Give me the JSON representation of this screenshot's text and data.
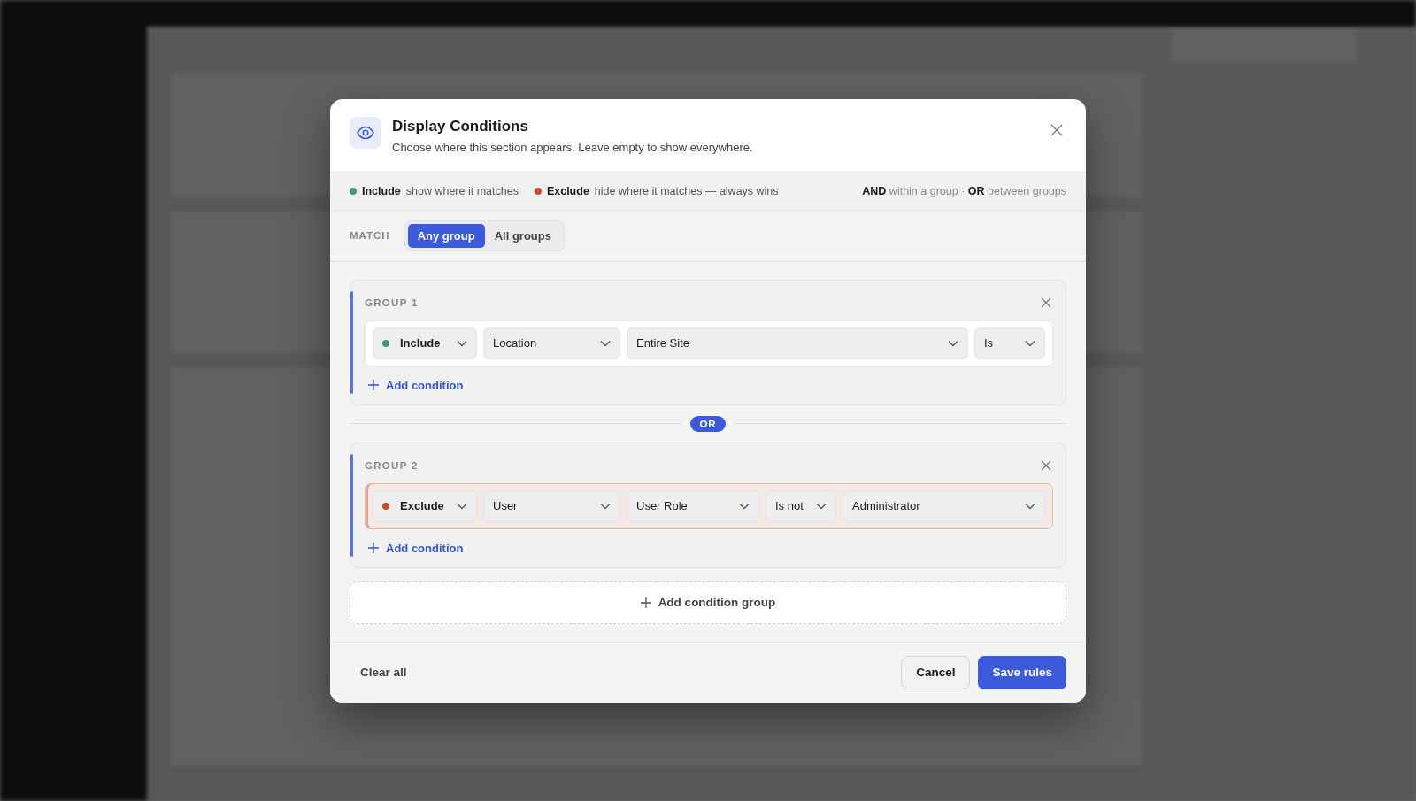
{
  "dialog": {
    "title": "Display Conditions",
    "subtitle": "Choose where this section appears. Leave empty to show everywhere.",
    "legend": [
      {
        "label": "Include",
        "text": "show where it matches",
        "color": "#3e9a6f"
      },
      {
        "label": "Exclude",
        "text": "hide where it matches — always wins",
        "color": "#c0502a"
      }
    ],
    "logic_hint": "**AND** within a group · **OR** between groups",
    "match": {
      "label": "MATCH",
      "options": [
        {
          "label": "Any group",
          "selected": true
        },
        {
          "label": "All groups",
          "selected": false
        }
      ]
    },
    "groups": [
      {
        "title": "GROUP 1",
        "conditions": [
          {
            "kind": "include",
            "mode": "Include",
            "color": "#3e9a6f",
            "fields": [
              {
                "kind": "type",
                "value": "Location"
              },
              {
                "kind": "target",
                "value": "Entire Site"
              },
              {
                "kind": "operator",
                "value": "Is"
              }
            ]
          }
        ],
        "add_label": "Add condition"
      },
      {
        "title": "GROUP 2",
        "conditions": [
          {
            "kind": "exclude",
            "mode": "Exclude",
            "color": "#c0502a",
            "fields": [
              {
                "kind": "type",
                "value": "User"
              },
              {
                "kind": "target",
                "value": "User Role"
              },
              {
                "kind": "operator",
                "value": "Is not"
              },
              {
                "kind": "value",
                "value": "Administrator"
              }
            ]
          }
        ],
        "add_label": "Add condition"
      }
    ],
    "separator": "OR",
    "add_group": "Add condition group",
    "clear": "Clear all",
    "cancel": "Cancel",
    "save": "Save rules"
  }
}
